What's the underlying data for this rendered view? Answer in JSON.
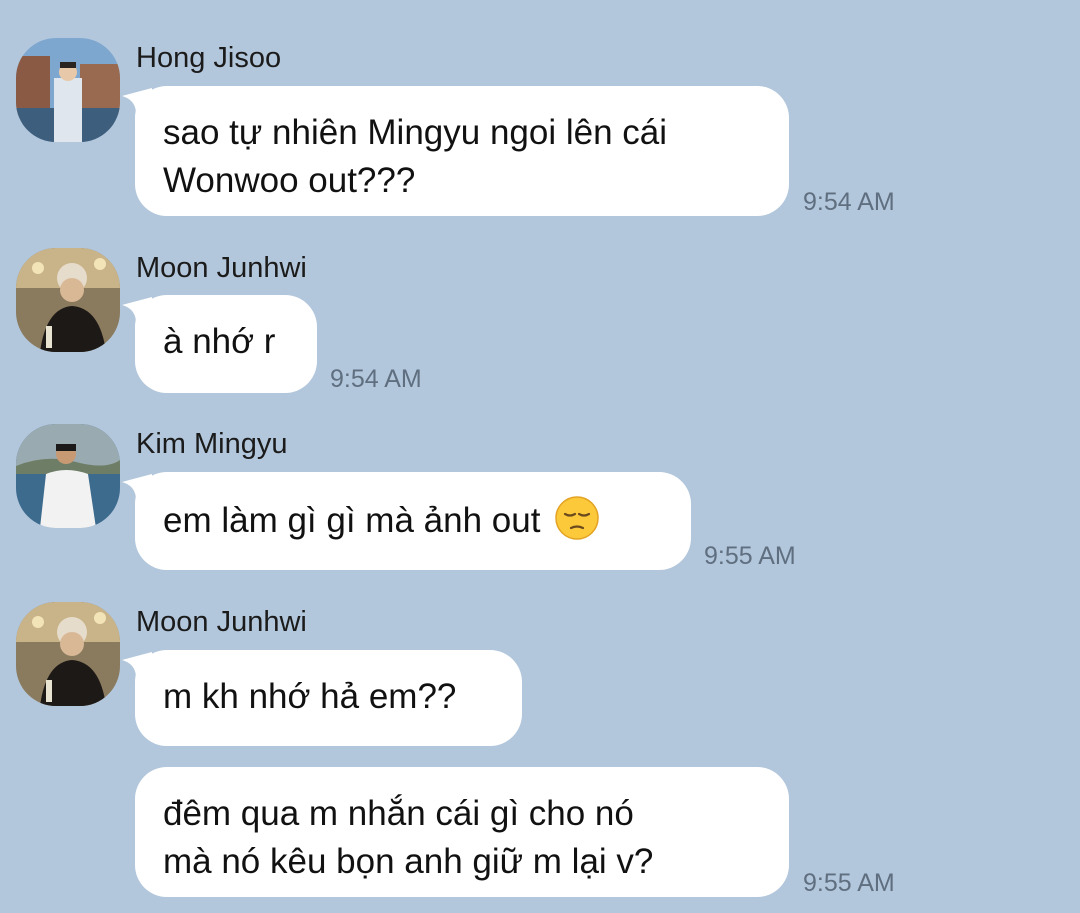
{
  "messages": [
    {
      "sender": "Hong Jisoo",
      "lines": [
        "sao tự nhiên Mingyu ngoi lên cái",
        "Wonwoo out???"
      ],
      "time": "9:54 AM"
    },
    {
      "sender": "Moon Junhwi",
      "lines": [
        "à nhớ r"
      ],
      "time": "9:54 AM"
    },
    {
      "sender": "Kim Mingyu",
      "lines": [
        "em làm gì gì mà ảnh out"
      ],
      "emoji": "pensive-face-emoji",
      "time": "9:55 AM"
    },
    {
      "sender": "Moon Junhwi",
      "lines": [
        "m kh nhớ hả em??"
      ]
    },
    {
      "lines": [
        "đêm qua m nhắn cái gì cho nó",
        "mà nó kêu bọn anh giữ m lại v?"
      ],
      "time": "9:55 AM"
    }
  ],
  "colors": {
    "background": "#b3c7dc",
    "bubble": "#ffffff",
    "timestamp": "#5f6f80"
  }
}
